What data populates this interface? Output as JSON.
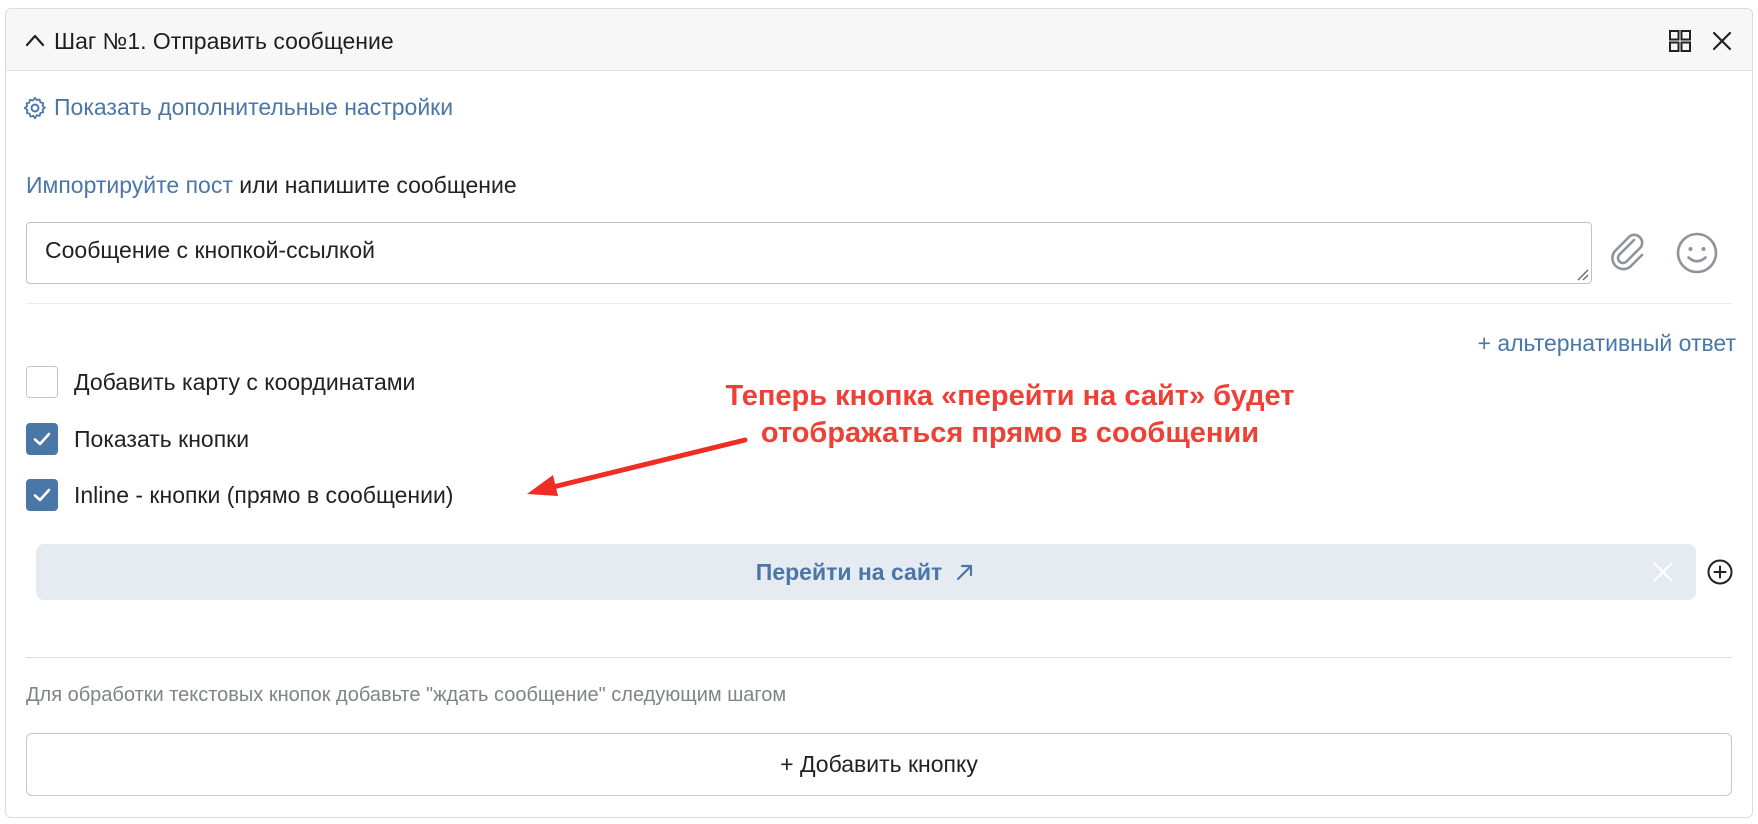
{
  "header": {
    "title": "Шаг №1. Отправить сообщение",
    "collapse_icon": "chevron-up-icon",
    "layout_icon": "grid-icon",
    "close_icon": "close-icon"
  },
  "settings": {
    "icon": "gear-icon",
    "label": "Показать дополнительные настройки"
  },
  "message": {
    "import_link": "Импортируйте пост",
    "import_rest": " или напишите сообщение",
    "text": "Сообщение с кнопкой-ссылкой",
    "attach_icon": "paperclip-icon",
    "emoji_icon": "smile-icon"
  },
  "alt_answer": "+ альтернативный ответ",
  "checkboxes": [
    {
      "label": "Добавить карту с координатами",
      "checked": false
    },
    {
      "label": "Показать кнопки",
      "checked": true
    },
    {
      "label": "Inline - кнопки (прямо в сообщении)",
      "checked": true
    }
  ],
  "annotation": {
    "line1": "Теперь кнопка «перейти на сайт» будет",
    "line2": "отображаться прямо в сообщении",
    "color": "#ef4035"
  },
  "link_button": {
    "label": "Перейти на сайт",
    "icon": "external-link-icon",
    "remove_icon": "close-icon",
    "add_icon": "plus-circle-icon"
  },
  "hint": "Для обработки текстовых кнопок добавьте \"ждать сообщение\" следующим шагом",
  "add_button": "+ Добавить кнопку",
  "colors": {
    "accent": "#4a76a8",
    "button_bg": "#e6ebf1",
    "header_bg": "#f7f7f8"
  }
}
